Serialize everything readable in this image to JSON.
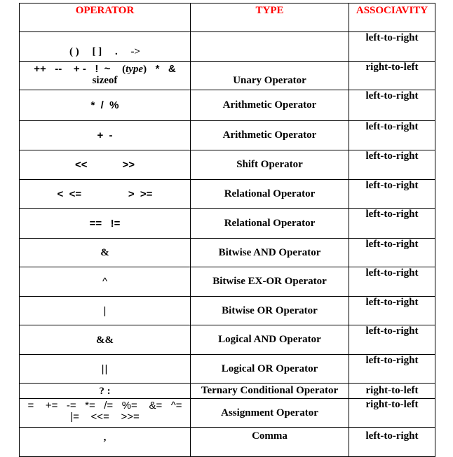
{
  "table": {
    "headers": {
      "operator": "OPERATOR",
      "type": "TYPE",
      "associativity": "ASSOCIAVITY"
    },
    "header_color": "#ff0000",
    "rows": [
      {
        "operator": "( )     [ ]     .     ->",
        "type": "",
        "associativity": "left-to-right"
      },
      {
        "operator_line1_a": "++   --    + -   !  ~",
        "operator_line1_type_open": "(",
        "operator_line1_type": "type",
        "operator_line1_type_close": ")",
        "operator_line1_b": "*   &",
        "operator_line2": "sizeof",
        "type": "Unary Operator",
        "associativity": "right-to-left"
      },
      {
        "operator": "*  /  %",
        "type": "Arithmetic Operator",
        "associativity": "left-to-right"
      },
      {
        "operator": "+  -",
        "type": "Arithmetic Operator",
        "associativity": "left-to-right"
      },
      {
        "operator": "<<            >>",
        "type": "Shift Operator",
        "associativity": "left-to-right"
      },
      {
        "operator": "<  <=                >  >=",
        "type": "Relational Operator",
        "associativity": "left-to-right"
      },
      {
        "operator": "==   !=",
        "type": "Relational Operator",
        "associativity": "left-to-right"
      },
      {
        "operator": "&",
        "type": "Bitwise AND Operator",
        "associativity": "left-to-right"
      },
      {
        "operator": "^",
        "type": "Bitwise EX-OR Operator",
        "associativity": "left-to-right"
      },
      {
        "operator": "|",
        "type": "Bitwise OR Operator",
        "associativity": "left-to-right"
      },
      {
        "operator": "&&",
        "type": "Logical AND Operator",
        "associativity": "left-to-right"
      },
      {
        "operator": "||",
        "type": "Logical OR Operator",
        "associativity": "left-to-right"
      },
      {
        "operator": "? :",
        "type": "Ternary Conditional Operator",
        "associativity": "right-to-left"
      },
      {
        "operator_line1": "=    +=   -=   *=   /=   %=    &=   ^=",
        "operator_line2": "|=    <<=    >>=",
        "type": "Assignment Operator",
        "associativity": "right-to-left"
      },
      {
        "operator": ",",
        "type": "Comma",
        "associativity": "left-to-right"
      }
    ]
  }
}
